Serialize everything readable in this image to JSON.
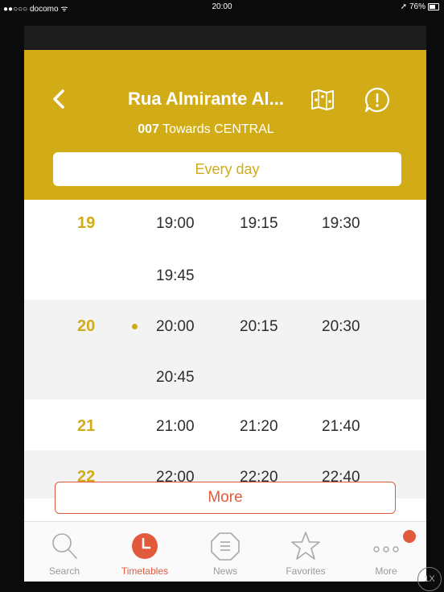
{
  "status_bar": {
    "carrier": "●●○○○ docomo ᯤ",
    "time": "20:00",
    "battery": "76%"
  },
  "header": {
    "stop_name": "Rua Almirante Al...",
    "route_number": "007",
    "direction": "Towards CENTRAL",
    "segment_label": "Every day",
    "icons": [
      "back-icon",
      "map-icon",
      "alert-icon"
    ],
    "accent_color": "#d1ac16"
  },
  "timetable": {
    "rows": [
      {
        "hour": "19",
        "times": [
          "19:00",
          "19:15",
          "19:30",
          "19:45"
        ],
        "current": false
      },
      {
        "hour": "20",
        "times": [
          "20:00",
          "20:15",
          "20:30",
          "20:45"
        ],
        "current": true
      },
      {
        "hour": "21",
        "times": [
          "21:00",
          "21:20",
          "21:40"
        ],
        "current": false
      },
      {
        "hour": "22",
        "times": [
          "22:00",
          "22:20",
          "22:40"
        ],
        "current": false
      }
    ]
  },
  "more_button": "More",
  "tabs": [
    {
      "label": "Search",
      "icon": "search-icon",
      "active": false
    },
    {
      "label": "Timetables",
      "icon": "clock-icon",
      "active": true
    },
    {
      "label": "News",
      "icon": "news-icon",
      "active": false
    },
    {
      "label": "Favorites",
      "icon": "star-icon",
      "active": false
    },
    {
      "label": "More",
      "icon": "more-dots-icon",
      "active": false
    }
  ],
  "zoom_label": "1X"
}
